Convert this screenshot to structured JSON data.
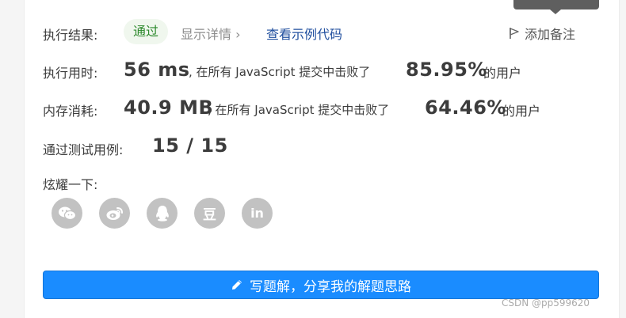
{
  "result": {
    "label": "执行结果:",
    "status": "通过",
    "details": "显示详情 ›",
    "example_link": "查看示例代码",
    "note": "添加备注"
  },
  "runtime": {
    "label": "执行用时:",
    "value": "56 ms",
    "mid": ", 在所有 JavaScript 提交中击败了",
    "percent": "85.95%",
    "suffix": "的用户"
  },
  "memory": {
    "label": "内存消耗:",
    "value": "40.9 MB",
    "mid": ", 在所有 JavaScript 提交中击败了",
    "percent": "64.46%",
    "suffix": "的用户"
  },
  "tests": {
    "label": "通过测试用例:",
    "value": "15 / 15"
  },
  "share": {
    "label": "炫耀一下:",
    "icons": [
      "wechat-icon",
      "weibo-icon",
      "qq-icon",
      "douban-icon",
      "linkedin-icon"
    ],
    "douban_glyph": "豆",
    "linkedin_glyph": "in"
  },
  "write_button": {
    "label": "写题解，分享我的解题思路",
    "icon": "pencil-icon",
    "color": "#1a8cff"
  },
  "watermark": "CSDN @pp599620"
}
